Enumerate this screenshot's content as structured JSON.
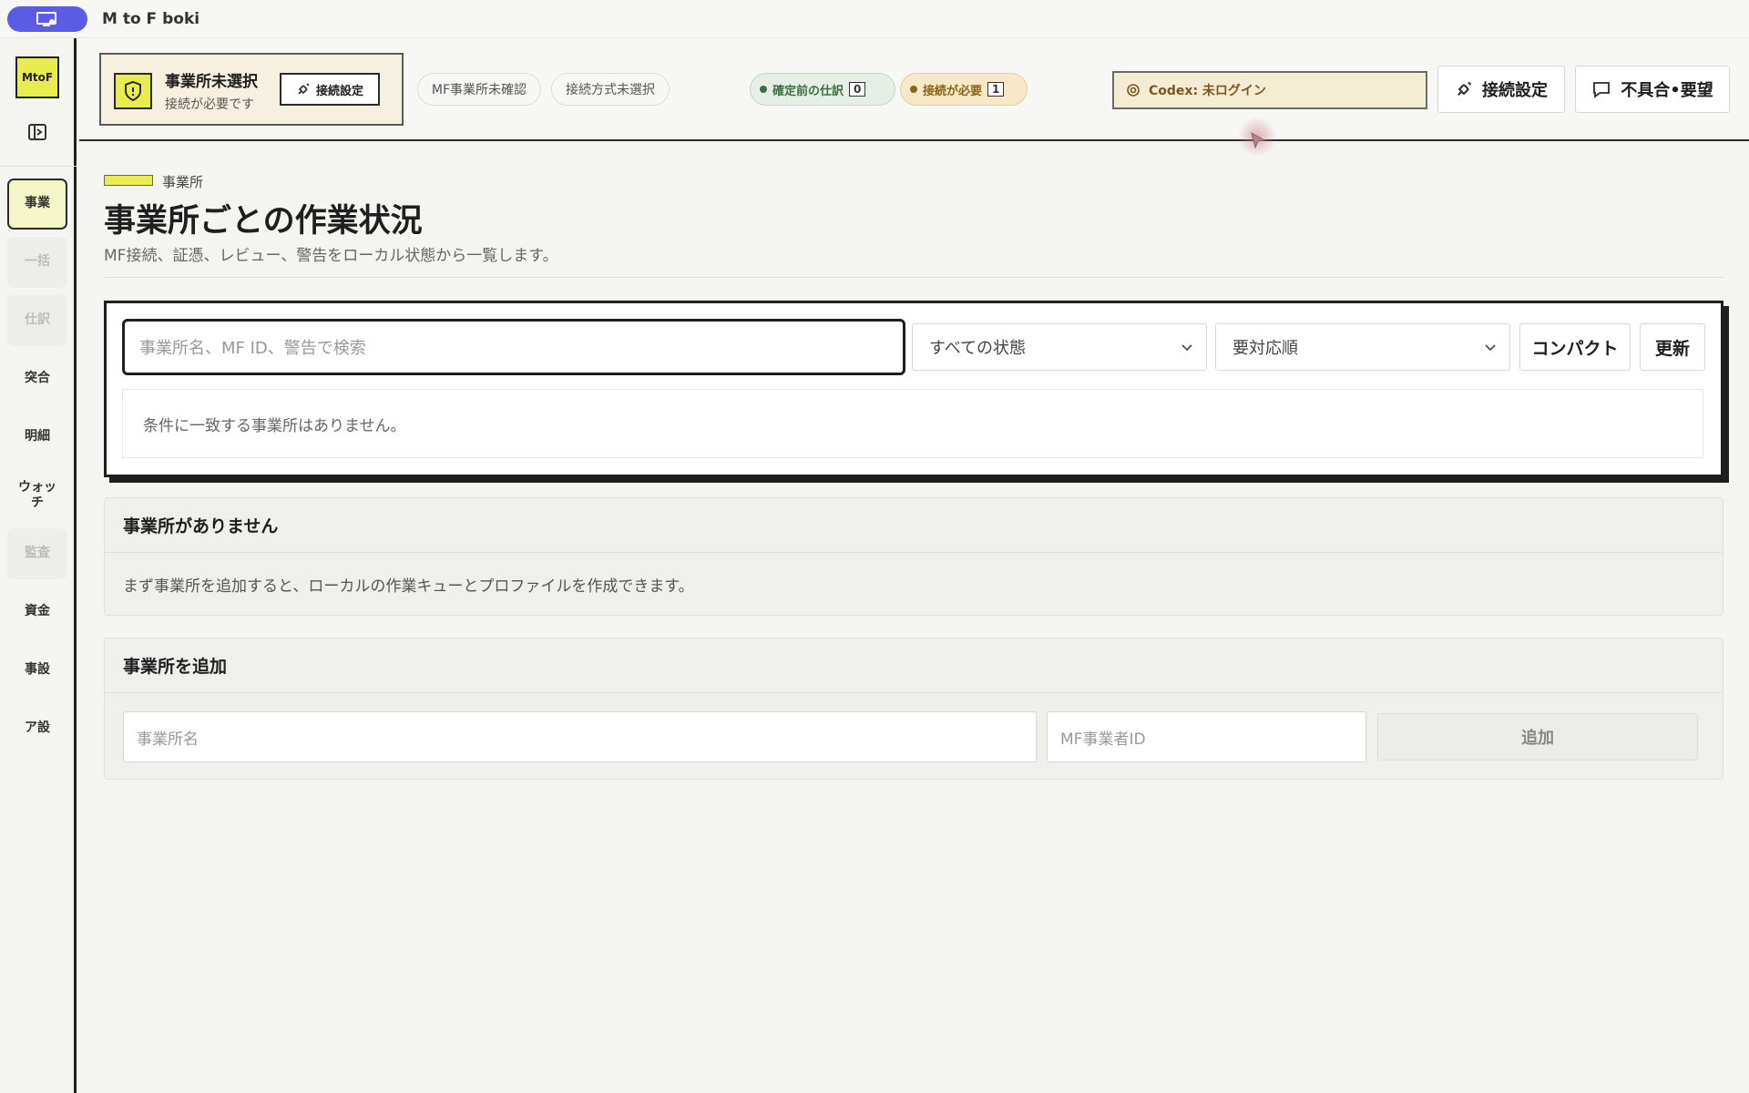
{
  "window": {
    "title": "M to F boki"
  },
  "rail": {
    "logo": "MtoF",
    "items": [
      {
        "label": "事業",
        "state": "active"
      },
      {
        "label": "一括",
        "state": "disabled"
      },
      {
        "label": "仕訳",
        "state": "disabled"
      },
      {
        "label": "突合",
        "state": "normal"
      },
      {
        "label": "明細",
        "state": "normal"
      },
      {
        "label": "ウォッチ",
        "state": "normal"
      },
      {
        "label": "監査",
        "state": "disabled"
      },
      {
        "label": "資金",
        "state": "normal"
      },
      {
        "label": "事設",
        "state": "normal"
      },
      {
        "label": "ア設",
        "state": "normal"
      }
    ]
  },
  "header": {
    "office": {
      "title": "事業所未選択",
      "subtitle": "接続が必要です",
      "button": "接続設定"
    },
    "chips": [
      "MF事業所未確認",
      "接続方式未選択"
    ],
    "status": [
      {
        "label": "確定前の仕訳",
        "count": "0",
        "color": "#3b6e43"
      },
      {
        "label": "接続が必要",
        "count": "1",
        "color": "#8a6418"
      }
    ],
    "codex": "Codex: 未ログイン",
    "connect_button": "接続設定",
    "feedback_button": "不具合•要望"
  },
  "main": {
    "breadcrumb": "事業所",
    "title": "事業所ごとの作業状況",
    "description": "MF接続、証憑、レビュー、警告をローカル状態から一覧します。",
    "filter": {
      "search_placeholder": "事業所名、MF ID、警告で検索",
      "status_select": "すべての状態",
      "sort_select": "要対応順",
      "compact_button": "コンパクト",
      "refresh_button": "更新",
      "empty_message": "条件に一致する事業所はありません。"
    },
    "empty_card": {
      "title": "事業所がありません",
      "body": "まず事業所を追加すると、ローカルの作業キューとプロファイルを作成できます。"
    },
    "add_card": {
      "title": "事業所を追加",
      "name_placeholder": "事業所名",
      "mfid_placeholder": "MF事業者ID",
      "add_button": "追加"
    }
  }
}
